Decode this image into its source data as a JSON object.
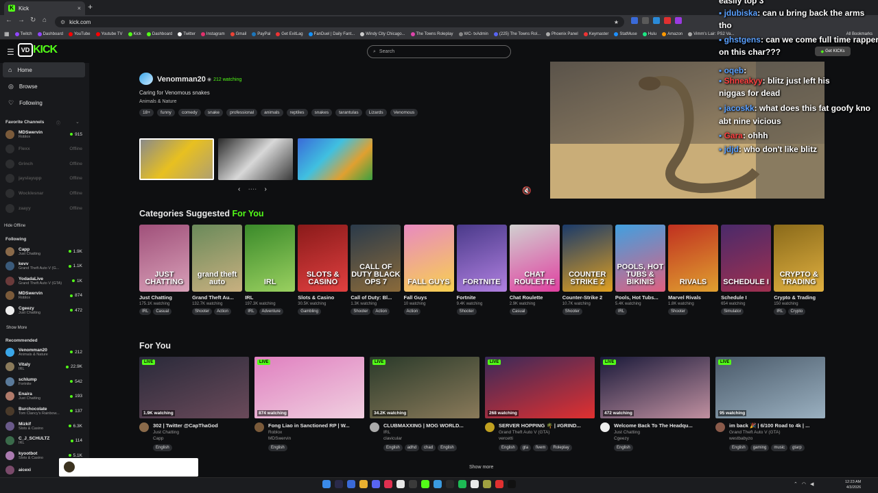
{
  "browser": {
    "tab_title": "Kick",
    "tab_close": "×",
    "new_tab": "+",
    "url": "kick.com",
    "bookmarks": [
      {
        "label": "Twitch",
        "color": "#9146ff"
      },
      {
        "label": "Dashboard",
        "color": "#9146ff"
      },
      {
        "label": "YouTube",
        "color": "#ff0000"
      },
      {
        "label": "Youtube TV",
        "color": "#ff0000"
      },
      {
        "label": "Kick",
        "color": "#53fc18"
      },
      {
        "label": "Dashboard",
        "color": "#53fc18"
      },
      {
        "label": "Twitter",
        "color": "#ffffff"
      },
      {
        "label": "Instagram",
        "color": "#e1306c"
      },
      {
        "label": "Gmail",
        "color": "#ea4335"
      },
      {
        "label": "PayPal",
        "color": "#1d76ba"
      },
      {
        "label": "Get ExitLag",
        "color": "#e33"
      },
      {
        "label": "FanDuel | Daily Fant...",
        "color": "#1493ff"
      },
      {
        "label": "Windy City Chicago...",
        "color": "#ccc"
      },
      {
        "label": "The Towns Roleplay",
        "color": "#d4a"
      },
      {
        "label": "WC- txAdmin",
        "color": "#888"
      },
      {
        "label": "(225) The Towns Rol...",
        "color": "#5865f2"
      },
      {
        "label": "Phoenix Panel",
        "color": "#aaa"
      },
      {
        "label": "Keymaster",
        "color": "#e33"
      },
      {
        "label": "StatMuse",
        "color": "#1e90ff"
      },
      {
        "label": "Hulu",
        "color": "#1ce783"
      },
      {
        "label": "Amazon",
        "color": "#ff9900"
      },
      {
        "label": "Vimm's Lair: PS2 Va...",
        "color": "#aaa"
      }
    ],
    "all_bookmarks": "All Bookmarks"
  },
  "header": {
    "search_placeholder": "Search",
    "get_kicks": "Get KICKs",
    "logo_badge": "VD",
    "logo_text": "KICK"
  },
  "sidebar": {
    "nav": [
      {
        "label": "Home",
        "icon": "home-icon"
      },
      {
        "label": "Browse",
        "icon": "compass-icon"
      },
      {
        "label": "Following",
        "icon": "heart-icon"
      }
    ],
    "favorites_title": "Favorite Channels",
    "favorites": [
      {
        "name": "MDSwervin",
        "game": "Roblox",
        "count": "915",
        "online": true,
        "color": "#7a5a3a"
      },
      {
        "name": "Flexx",
        "game": "",
        "count": "Offline",
        "online": false,
        "color": "#555"
      },
      {
        "name": "Grinch",
        "game": "",
        "count": "Offline",
        "online": false,
        "color": "#555"
      },
      {
        "name": "jayslayupp",
        "game": "",
        "count": "Offline",
        "online": false,
        "color": "#555"
      },
      {
        "name": "Wocklesnar",
        "game": "",
        "count": "Offline",
        "online": false,
        "color": "#555"
      },
      {
        "name": "zaayy",
        "game": "",
        "count": "Offline",
        "online": false,
        "color": "#555"
      }
    ],
    "hide_offline": "Hide Offline",
    "following_title": "Following",
    "following": [
      {
        "name": "Capp",
        "game": "Just Chatting",
        "count": "1.9K",
        "color": "#8a6a4a"
      },
      {
        "name": "kevv",
        "game": "Grand Theft Auto V (G...",
        "count": "1.1K",
        "color": "#3a5a7a"
      },
      {
        "name": "YodadaLive",
        "game": "Grand Theft Auto V (GTA)",
        "count": "1K",
        "color": "#6a3a3a"
      },
      {
        "name": "MDSwervin",
        "game": "Roblox",
        "count": "874",
        "color": "#7a5a3a"
      },
      {
        "name": "Cgeezy",
        "game": "Just Chatting",
        "count": "472",
        "color": "#eeeeee"
      }
    ],
    "show_more": "Show More",
    "recommended_title": "Recommended",
    "recommended": [
      {
        "name": "Venomman20",
        "game": "Animals & Nature",
        "count": "212",
        "color": "#3aa6e8"
      },
      {
        "name": "Vitaly",
        "game": "IRL",
        "count": "22.9K",
        "color": "#8a7a5a"
      },
      {
        "name": "schlump",
        "game": "Fortnite",
        "count": "542",
        "color": "#5a7a9a"
      },
      {
        "name": "Enaira",
        "game": "Just Chatting",
        "count": "193",
        "color": "#b07a6a"
      },
      {
        "name": "Burchocolate",
        "game": "Tom Clancy's Rainbow...",
        "count": "137",
        "color": "#4a3a2a"
      },
      {
        "name": "Mizkif",
        "game": "Slots & Casino",
        "count": "6.3K",
        "color": "#6a5a8a"
      },
      {
        "name": "C_J_SCHULTZ",
        "game": "IRL",
        "count": "114",
        "color": "#3a6a4a"
      },
      {
        "name": "kyootbot",
        "game": "Slots & Casino",
        "count": "5.1K",
        "color": "#aa7ab0"
      },
      {
        "name": "aicexi",
        "game": "",
        "count": "",
        "color": "#7a4a6a"
      }
    ]
  },
  "hero": {
    "name": "Venomman20",
    "watching": "212 watching",
    "title": "Caring for Venomous snakes",
    "category": "Animals & Nature",
    "tags": [
      "18+",
      "funny",
      "comedy",
      "snake",
      "professional",
      "animals",
      "reptiles",
      "snakes",
      "tarantulas",
      "Lizards",
      "Venomous"
    ],
    "prev": "‹",
    "next": "›",
    "dots": "• • • •"
  },
  "chat": [
    {
      "user": "",
      "text": "easily top 3"
    },
    {
      "user": "jdubiska",
      "text": ": can u bring back the arms"
    },
    {
      "user": "",
      "text": "tho"
    },
    {
      "user": "ghstgens",
      "text": ": can we come full time rapper"
    },
    {
      "user": "",
      "text": "on this char???"
    },
    {
      "user": "oqeb",
      "text": ":"
    },
    {
      "user": "Shneakyy",
      "text": ": blitz just left his"
    },
    {
      "user": "",
      "text": "niggas for dead"
    },
    {
      "user": "jacoskk",
      "text": ": what does this fat goofy kno"
    },
    {
      "user": "",
      "text": "abt nine vicious"
    },
    {
      "user": "Gara",
      "text": ": ohhh"
    },
    {
      "user": "jdjd",
      "text": ": who don't like blitz"
    }
  ],
  "categories_section": {
    "title_a": "Categories Suggested ",
    "title_b": "For You"
  },
  "categories": [
    {
      "name": "Just Chatting",
      "watching": "175.1K watching",
      "tags": [
        "IRL",
        "Casual"
      ],
      "label": "JUST CHATTING",
      "bg": "linear-gradient(160deg,#a0507a,#d8a0b8)"
    },
    {
      "name": "Grand Theft Au...",
      "watching": "132.7K watching",
      "tags": [
        "Shooter",
        "Action"
      ],
      "label": "grand theft auto",
      "bg": "linear-gradient(160deg,#6a8a5a,#c8b080)"
    },
    {
      "name": "IRL",
      "watching": "197.3K watching",
      "tags": [
        "IRL",
        "Adventure"
      ],
      "label": "IRL",
      "bg": "linear-gradient(160deg,#3a8a2a,#9ad060)"
    },
    {
      "name": "Slots & Casino",
      "watching": "30.5K watching",
      "tags": [
        "Gambling"
      ],
      "label": "SLOTS & CASINO",
      "bg": "linear-gradient(160deg,#8a1a1a,#e04040)"
    },
    {
      "name": "Call of Duty: Bl...",
      "watching": "1.3K watching",
      "tags": [
        "Shooter",
        "Action"
      ],
      "label": "CALL OF DUTY BLACK OPS 7",
      "bg": "linear-gradient(160deg,#2a3a4a,#8a6a3a)"
    },
    {
      "name": "Fall Guys",
      "watching": "10 watching",
      "tags": [
        "Action"
      ],
      "label": "FALL GUYS",
      "bg": "linear-gradient(160deg,#e88ac0,#f8d050)"
    },
    {
      "name": "Fortnite",
      "watching": "9.4K watching",
      "tags": [
        "Shooter"
      ],
      "label": "FORTNITE",
      "bg": "linear-gradient(160deg,#4a3a8a,#b080e0)"
    },
    {
      "name": "Chat Roulette",
      "watching": "2.9K watching",
      "tags": [
        "Casual"
      ],
      "label": "CHAT ROULETTE",
      "bg": "linear-gradient(160deg,#d0d0d0,#e040a0)"
    },
    {
      "name": "Counter-Strike 2",
      "watching": "10.7K watching",
      "tags": [
        "Shooter"
      ],
      "label": "COUNTER STRIKE 2",
      "bg": "linear-gradient(160deg,#1a3a6a,#e0a020)"
    },
    {
      "name": "Pools, Hot Tubs...",
      "watching": "5.4K watching",
      "tags": [
        "IRL"
      ],
      "label": "POOLS, HOT TUBS & BIKINIS",
      "bg": "linear-gradient(160deg,#40a0e0,#e06080)"
    },
    {
      "name": "Marvel Rivals",
      "watching": "1.8K watching",
      "tags": [
        "Shooter"
      ],
      "label": "RIVALS",
      "bg": "linear-gradient(160deg,#c03020,#e0a030)"
    },
    {
      "name": "Schedule I",
      "watching": "654 watching",
      "tags": [
        "Simulator"
      ],
      "label": "SCHEDULE I",
      "bg": "linear-gradient(160deg,#4a2a6a,#a03050)"
    },
    {
      "name": "Crypto & Trading",
      "watching": "150 watching",
      "tags": [
        "IRL",
        "Crypto"
      ],
      "label": "CRYPTO & TRADING",
      "bg": "linear-gradient(160deg,#8a6a1a,#e0b040)"
    }
  ],
  "for_you_title": "For You",
  "streams": [
    {
      "title": "302 | Twitter @CapThaGod",
      "game": "Just Chatting",
      "user": "Capp",
      "viewers": "1.9K watching",
      "tags": [
        "English"
      ],
      "bg": "linear-gradient(160deg,#2a2a3a,#6a4a5a)",
      "av": "#8a6a4a"
    },
    {
      "title": "Fong Liao in Sanctioned RP | W...",
      "game": "Roblox",
      "user": "MDSwervin",
      "viewers": "874 watching",
      "tags": [
        "English"
      ],
      "bg": "linear-gradient(160deg,#e080c0,#f0d0e0)",
      "av": "#7a5a3a"
    },
    {
      "title": "CLUBMAXXING | MOG WORLD...",
      "game": "IRL",
      "user": "clavicular",
      "viewers": "34.2K watching",
      "tags": [
        "English",
        "adhd",
        "chad",
        "English"
      ],
      "bg": "linear-gradient(160deg,#2a3a2a,#8a7a5a)",
      "av": "#aaa"
    },
    {
      "title": "SERVER HOPPING 🌴 | #GRIND...",
      "game": "Grand Theft Auto V (GTA)",
      "user": "vercetti",
      "viewers": "268 watching",
      "tags": [
        "English",
        "gta",
        "fivem",
        "Roleplay"
      ],
      "bg": "linear-gradient(160deg,#3a2a5a,#e03030)",
      "av": "#c0a020"
    },
    {
      "title": "Welcome Back To The Headqu...",
      "game": "Just Chatting",
      "user": "Cgeezy",
      "viewers": "472 watching",
      "tags": [
        "English"
      ],
      "bg": "linear-gradient(160deg,#1a1a3a,#c090a0)",
      "av": "#eeeeee"
    },
    {
      "title": "im back 🎉 | 6/100 Road to 4k | ...",
      "game": "Grand Theft Auto V (GTA)",
      "user": "westbabyzo",
      "viewers": "95 watching",
      "tags": [
        "English",
        "gaming",
        "music",
        "gtarp"
      ],
      "bg": "linear-gradient(160deg,#4a5a6a,#9ab0c0)",
      "av": "#8a5a4a"
    }
  ],
  "live_label": "LIVE",
  "show_more": "Show more",
  "taskbar": {
    "time": "12:23 AM",
    "date": "4/3/2026"
  }
}
